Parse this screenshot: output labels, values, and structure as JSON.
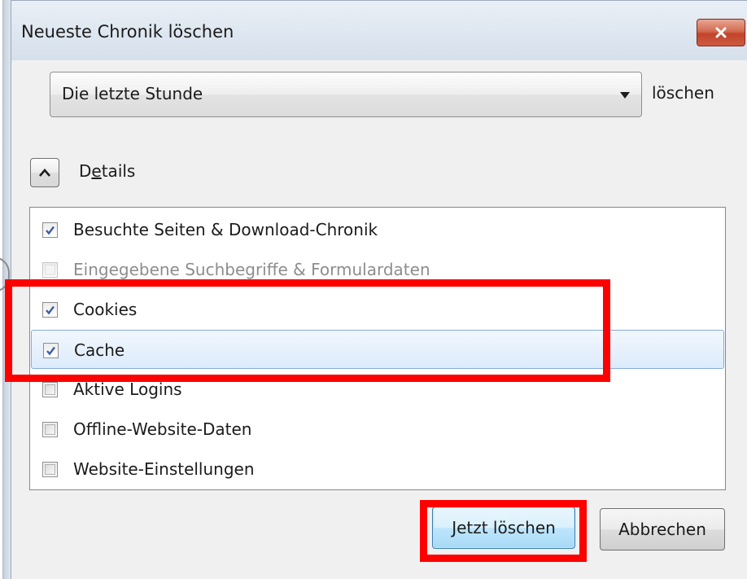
{
  "window": {
    "title": "Neueste Chronik löschen"
  },
  "range": {
    "selected": "Die letzte Stunde",
    "suffix": "löschen"
  },
  "details": {
    "label_prefix": "D",
    "label_accel": "e",
    "label_rest": "tails",
    "expanded": true
  },
  "items": [
    {
      "label": "Besuchte Seiten & Download-Chronik",
      "checked": true,
      "disabled": false
    },
    {
      "label": "Eingegebene Suchbegriffe & Formulardaten",
      "checked": false,
      "disabled": true
    },
    {
      "label": "Cookies",
      "checked": true,
      "disabled": false
    },
    {
      "label": "Cache",
      "checked": true,
      "disabled": false,
      "selected": true
    },
    {
      "label": "Aktive Logins",
      "checked": false,
      "disabled": false
    },
    {
      "label": "Offline-Website-Daten",
      "checked": false,
      "disabled": false
    },
    {
      "label": "Website-Einstellungen",
      "checked": false,
      "disabled": false
    }
  ],
  "buttons": {
    "clear": "Jetzt löschen",
    "cancel": "Abbrechen"
  },
  "icons": {
    "close": "close-icon",
    "dropdown": "chevron-down-icon",
    "toggle": "chevron-up-icon",
    "check": "checkmark-icon"
  },
  "colors": {
    "annotation": "#ff0000",
    "close_button": "#c7503a",
    "selection": "#dcebfc",
    "check": "#3a5da8"
  }
}
